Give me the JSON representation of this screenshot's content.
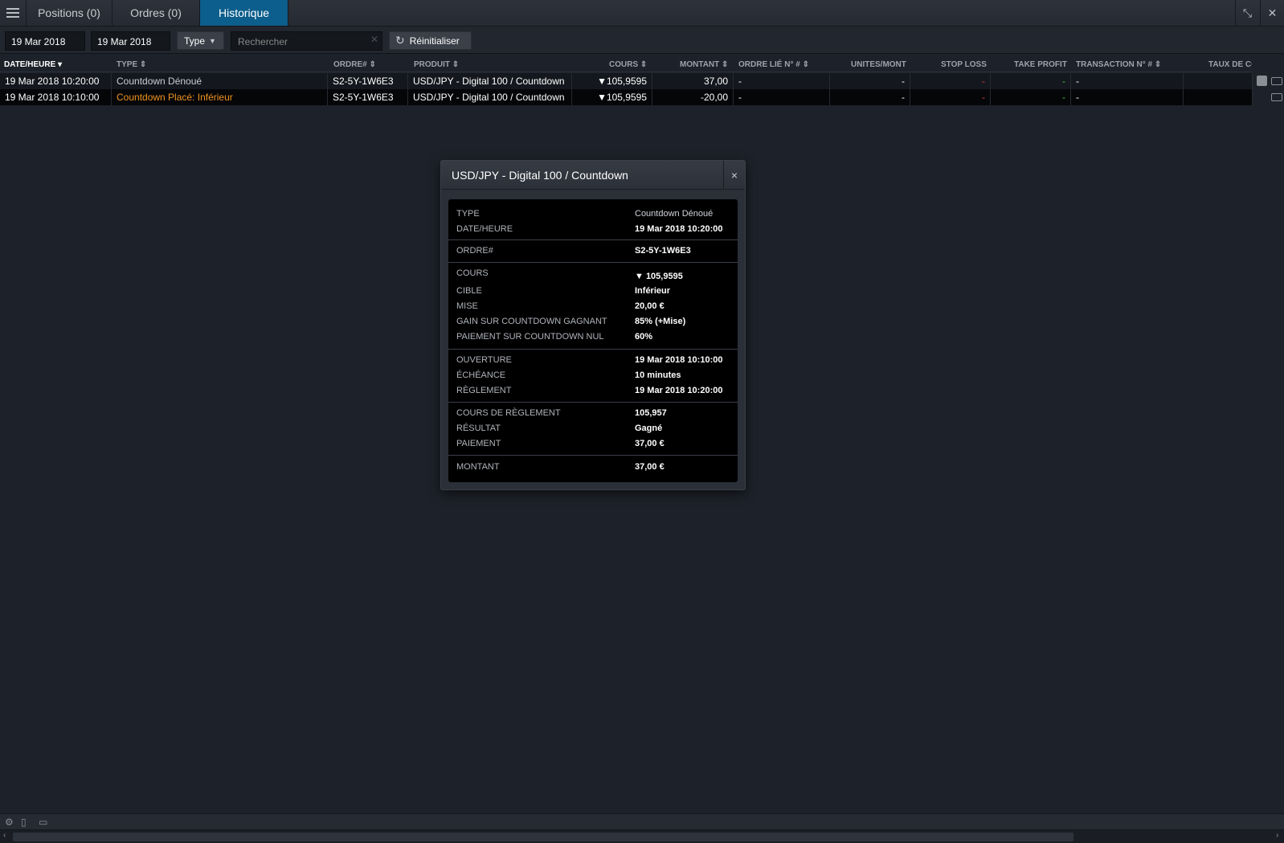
{
  "tabs": [
    {
      "label": "Positions (0)"
    },
    {
      "label": "Ordres (0)"
    },
    {
      "label": "Historique",
      "active": true
    }
  ],
  "filters": {
    "date_from": "19 Mar 2018",
    "date_to": "19 Mar 2018",
    "type_label": "Type",
    "search_placeholder": "Rechercher",
    "reset_label": "Réinitialiser"
  },
  "table": {
    "headers": {
      "date": "DATE/HEURE",
      "type": "TYPE",
      "order": "ORDRE#",
      "product": "PRODUIT",
      "price": "COURS",
      "amount": "MONTANT",
      "linked_order": "ORDRE LIÉ N° #",
      "units": "UNITES/MONT",
      "stop_loss": "STOP LOSS",
      "take_profit": "TAKE PROFIT",
      "transaction": "TRANSACTION N° #",
      "rate": "TAUX DE CO"
    },
    "rows": [
      {
        "date": "19 Mar 2018 10:20:00",
        "type": "Countdown Dénoué",
        "order": "S2-5Y-1W6E3",
        "product": "USD/JPY - Digital 100 / Countdown",
        "price": "▼105,9595",
        "amount": "37,00",
        "linked_order": "-",
        "units": "-",
        "stop_loss": "-",
        "take_profit": "-",
        "transaction": "-"
      },
      {
        "date": "19 Mar 2018 10:10:00",
        "type": "Countdown Placé: Inférieur",
        "order": "S2-5Y-1W6E3",
        "product": "USD/JPY - Digital 100 / Countdown",
        "price": "▼105,9595",
        "amount": "-20,00",
        "linked_order": "-",
        "units": "-",
        "stop_loss": "-",
        "take_profit": "-",
        "transaction": "-"
      }
    ]
  },
  "modal": {
    "title": "USD/JPY - Digital 100 / Countdown",
    "close": "×",
    "fields": {
      "type_k": "TYPE",
      "type_v": "Countdown Dénoué",
      "date_k": "DATE/HEURE",
      "date_v": "19 Mar 2018 10:20:00",
      "order_k": "ORDRE#",
      "order_v": "S2-5Y-1W6E3",
      "price_k": "COURS",
      "price_v": "▼ 105,9595",
      "target_k": "CIBLE",
      "target_v": "Inférieur",
      "stake_k": "MISE",
      "stake_v": "20,00 €",
      "gain_k": "GAIN SUR COUNTDOWN GAGNANT",
      "gain_v": "85% (+Mise)",
      "payout_null_k": "PAIEMENT SUR COUNTDOWN NUL",
      "payout_null_v": "60%",
      "open_k": "OUVERTURE",
      "open_v": "19 Mar 2018 10:10:00",
      "expiry_k": "ÉCHÉANCE",
      "expiry_v": "10 minutes",
      "settle_k": "RÈGLEMENT",
      "settle_v": "19 Mar 2018 10:20:00",
      "settle_price_k": "COURS DE RÈGLEMENT",
      "settle_price_v": "105,957",
      "result_k": "RÉSULTAT",
      "result_v": "Gagné",
      "payment_k": "PAIEMENT",
      "payment_v": "37,00 €",
      "amount_k": "MONTANT",
      "amount_v": "37,00 €"
    }
  },
  "colors": {
    "active_tab": "#0c5e8c",
    "placed_order_text": "#f0931e",
    "stop_loss_dash": "#d33b3b",
    "take_profit_dash": "#46c246"
  }
}
